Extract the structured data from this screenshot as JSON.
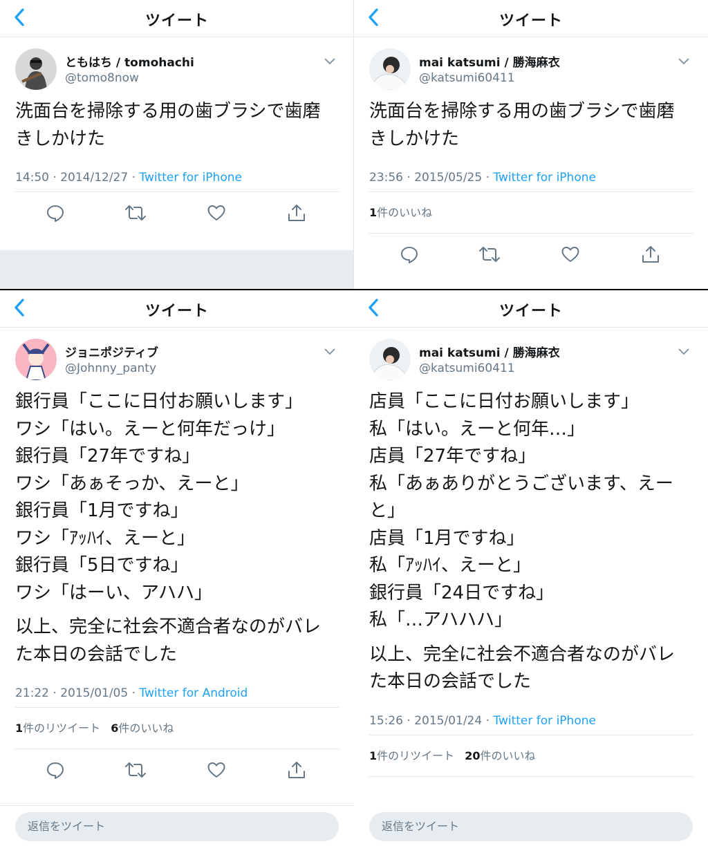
{
  "common": {
    "top_title": "ツイート"
  },
  "tweets": [
    {
      "display_name": "ともはち / tomohachi",
      "handle": "@tomo8now",
      "body_lines": [
        "洗面台を掃除する用の歯ブラシで歯磨",
        "きしかけた"
      ],
      "time": "14:50 · 2014/12/27 · ",
      "source": "Twitter for iPhone"
    },
    {
      "display_name": "mai katsumi / 勝海麻衣",
      "handle": "@katsumi60411",
      "body_lines": [
        "洗面台を掃除する用の歯ブラシで歯磨",
        "きしかけた"
      ],
      "time": "23:56 · 2015/05/25 · ",
      "source": "Twitter for iPhone",
      "likes_count": "1",
      "likes_label": "件のいいね"
    },
    {
      "display_name": "ジョニポジティブ",
      "handle": "@Johnny_panty",
      "body_lines": [
        "銀行員「ここに日付お願いします」",
        "ワシ「はい。えーと何年だっけ」",
        "銀行員「27年ですね」",
        "ワシ「あぁそっか、えーと」",
        "銀行員「1月ですね」",
        "ワシ「ｱｯﾊｲ、えーと」",
        "銀行員「5日ですね」",
        "ワシ「はーい、アハハ」"
      ],
      "body_tail": [
        "以上、完全に社会不適合者なのがバレ",
        "た本日の会話でした"
      ],
      "time": "21:22 · 2015/01/05 · ",
      "source": "Twitter for Android",
      "retweets_count": "1",
      "retweets_label": "件のリツイート",
      "likes_count": "6",
      "likes_label": "件のいいね",
      "reply_placeholder": "返信をツイート"
    },
    {
      "display_name": "mai katsumi / 勝海麻衣",
      "handle": "@katsumi60411",
      "body_lines": [
        "店員「ここに日付お願いします」",
        "私「はい。えーと何年…」",
        "店員「27年ですね」",
        "私「あぁありがとうございます、えー",
        "と」",
        "店員「1月ですね」",
        "私「ｱｯﾊｲ、えーと」",
        "銀行員「24日ですね」",
        "私「…アハハハ」"
      ],
      "body_tail": [
        "以上、完全に社会不適合者なのがバレ",
        "た本日の会話でした"
      ],
      "time": "15:26 · 2015/01/24 · ",
      "source": "Twitter for iPhone",
      "retweets_count": "1",
      "retweets_label": "件のリツイート",
      "likes_count": "20",
      "likes_label": "件のいいね",
      "reply_placeholder": "返信をツイート"
    }
  ],
  "colors": {
    "accent": "#1da1f2",
    "secondary_text": "#657786",
    "divider": "#e1e8ed",
    "fill": "#e6ecf0"
  }
}
